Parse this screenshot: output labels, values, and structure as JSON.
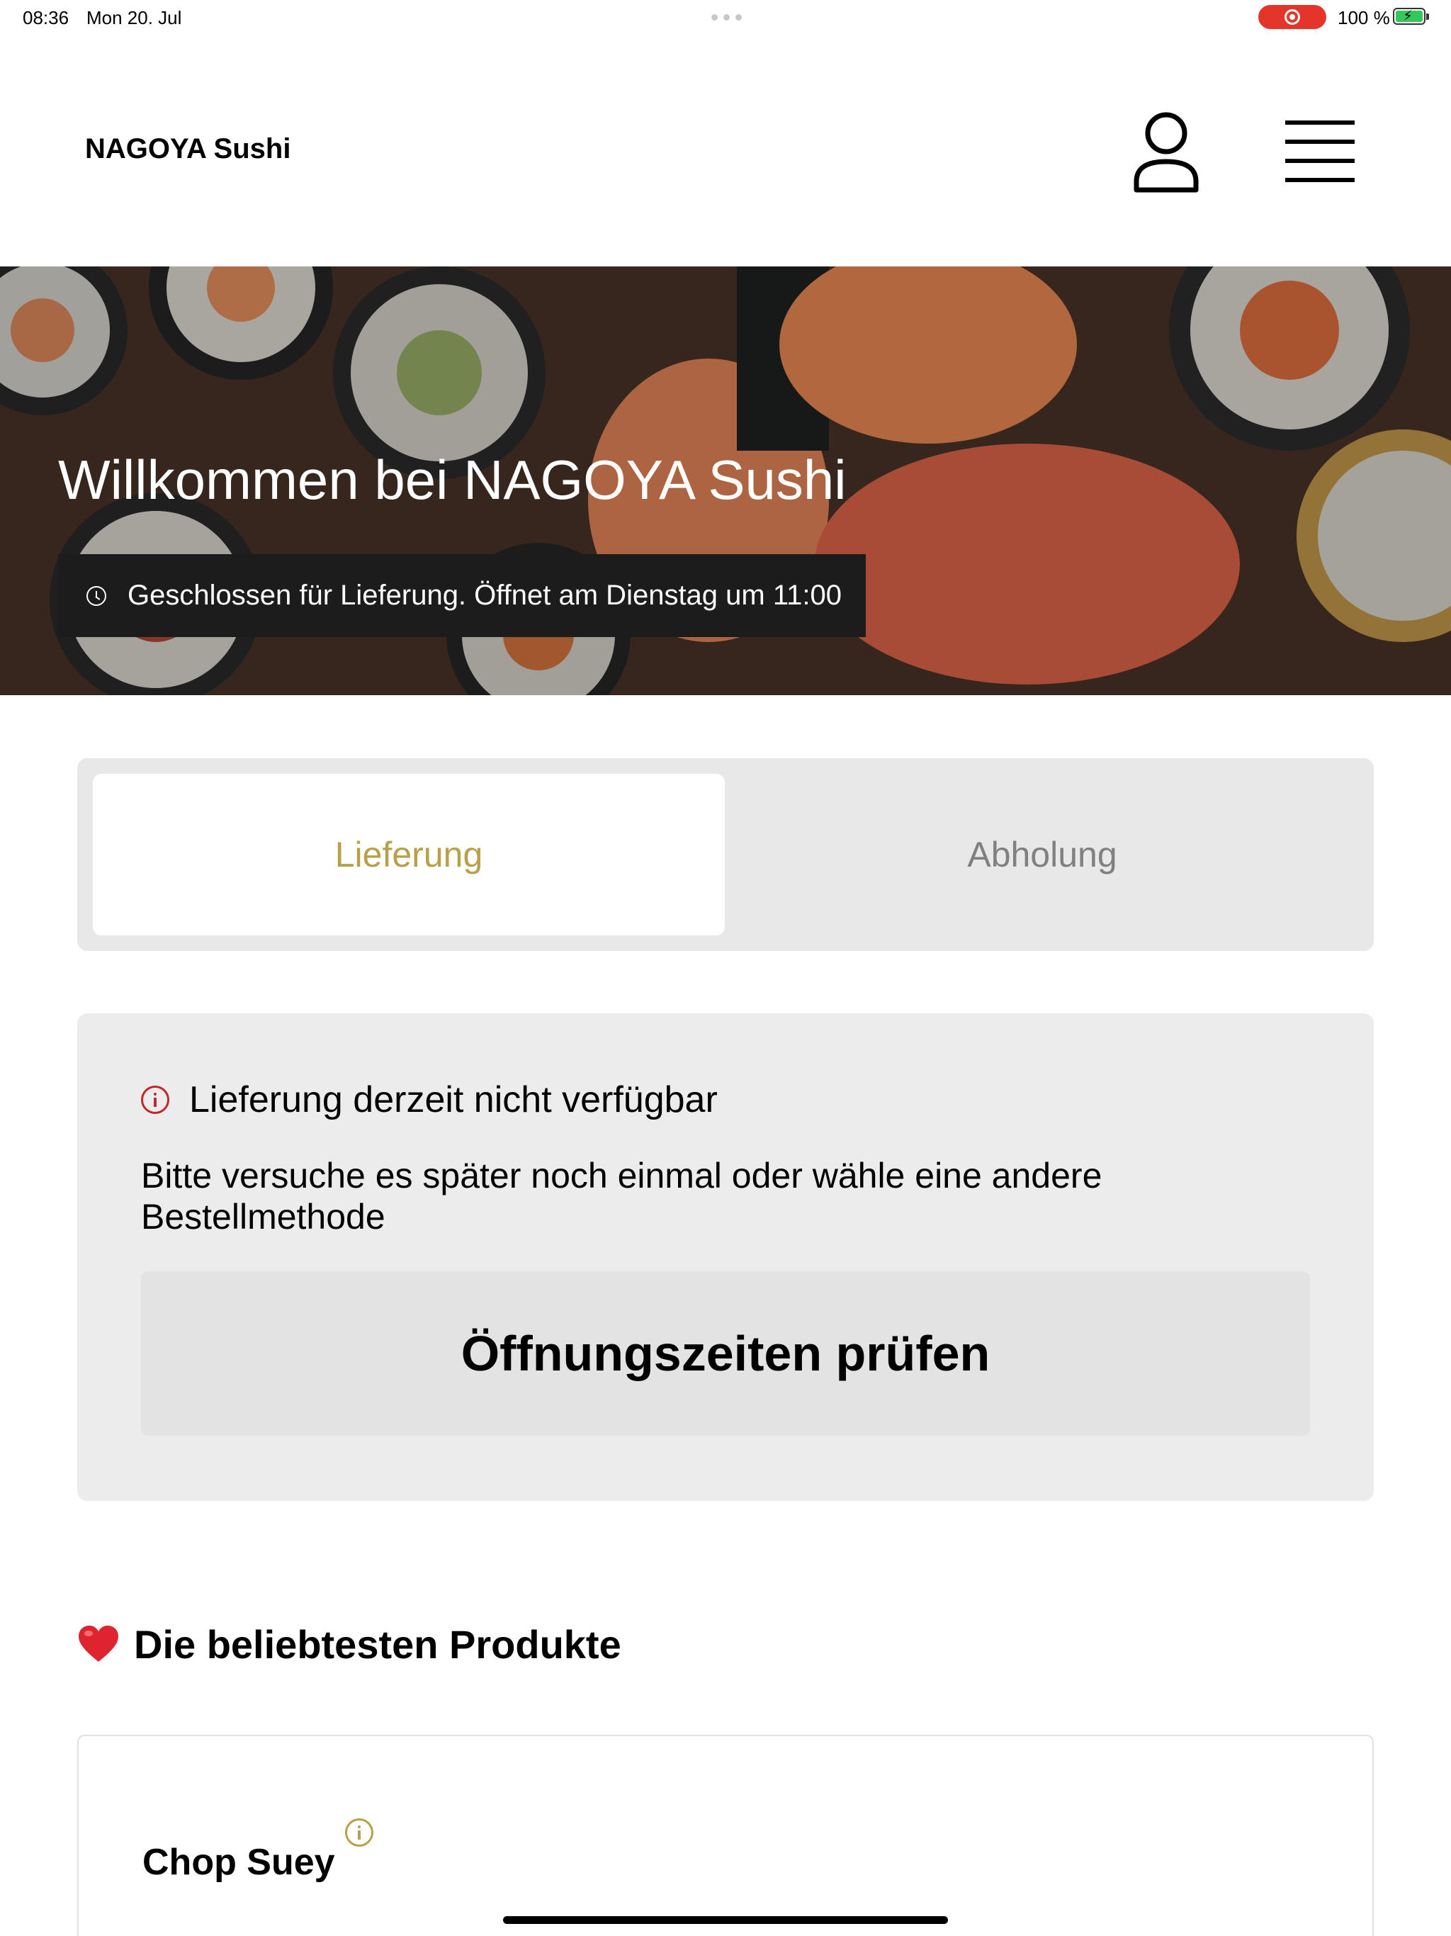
{
  "status_bar": {
    "time": "08:36",
    "date": "Mon 20. Jul",
    "battery": "100 %"
  },
  "header": {
    "brand": "NAGOYA Sushi"
  },
  "hero": {
    "title": "Willkommen bei NAGOYA Sushi",
    "status": "Geschlossen für Lieferung. Öffnet am Dienstag um 11:00"
  },
  "order_mode": {
    "tabs": [
      {
        "label": "Lieferung",
        "active": true
      },
      {
        "label": "Abholung",
        "active": false
      }
    ]
  },
  "notice": {
    "title": "Lieferung derzeit nicht verfügbar",
    "message": "Bitte versuche es später noch einmal oder wähle eine andere Bestellmethode",
    "button": "Öffnungszeiten prüfen"
  },
  "popular": {
    "title": "Die beliebtesten Produkte",
    "products": [
      {
        "name": "Chop Suey"
      }
    ]
  },
  "colors": {
    "accent": "#b8a049",
    "alert": "#c1272d",
    "card_bg": "#ececec"
  }
}
